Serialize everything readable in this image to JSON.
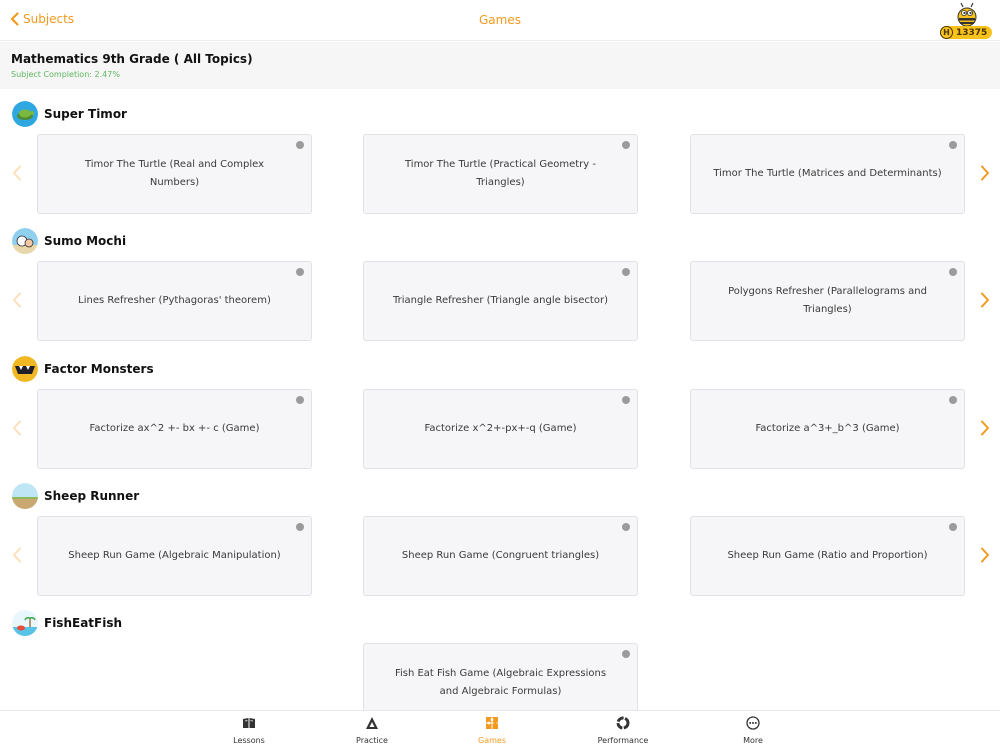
{
  "header": {
    "back_label": "Subjects",
    "title": "Games",
    "score_badge": "H",
    "score": "13375"
  },
  "subject": {
    "title": "Mathematics 9th Grade ( All Topics)",
    "completion": "Subject Completion: 2.47%"
  },
  "sections": [
    {
      "title": "Super Timor",
      "icon": "turtle-game-icon",
      "cards": [
        "Timor The Turtle (Real and Complex Numbers)",
        "Timor The Turtle (Practical Geometry - Triangles)",
        "Timor The Turtle (Matrices and Determinants)"
      ]
    },
    {
      "title": "Sumo Mochi",
      "icon": "sumo-game-icon",
      "cards": [
        "Lines Refresher (Pythagoras' theorem)",
        "Triangle Refresher (Triangle angle bisector)",
        "Polygons Refresher (Parallelograms and Triangles)"
      ]
    },
    {
      "title": "Factor Monsters",
      "icon": "monster-game-icon",
      "cards": [
        "Factorize ax^2 +- bx +- c (Game)",
        "Factorize x^2+-px+-q (Game)",
        "Factorize a^3+_b^3 (Game)"
      ]
    },
    {
      "title": "Sheep Runner",
      "icon": "sheep-game-icon",
      "cards": [
        "Sheep Run Game (Algebraic Manipulation)",
        "Sheep Run Game (Congruent triangles)",
        "Sheep Run Game (Ratio and Proportion)"
      ]
    },
    {
      "title": "FishEatFish",
      "icon": "fish-game-icon",
      "cards": [
        "Fish Eat Fish Game (Algebraic Expressions and Algebraic Formulas)"
      ]
    }
  ],
  "nav": {
    "items": [
      {
        "label": "Lessons",
        "icon": "book-icon"
      },
      {
        "label": "Practice",
        "icon": "triangle-icon"
      },
      {
        "label": "Games",
        "icon": "puzzle-icon"
      },
      {
        "label": "Performance",
        "icon": "chart-ring-icon"
      },
      {
        "label": "More",
        "icon": "more-dots-icon"
      }
    ],
    "active": "Games"
  },
  "colors": {
    "accent": "#f29a1f",
    "completion": "#5cb85c",
    "card_bg": "#f6f6f8",
    "badge": "#f7c21b"
  }
}
